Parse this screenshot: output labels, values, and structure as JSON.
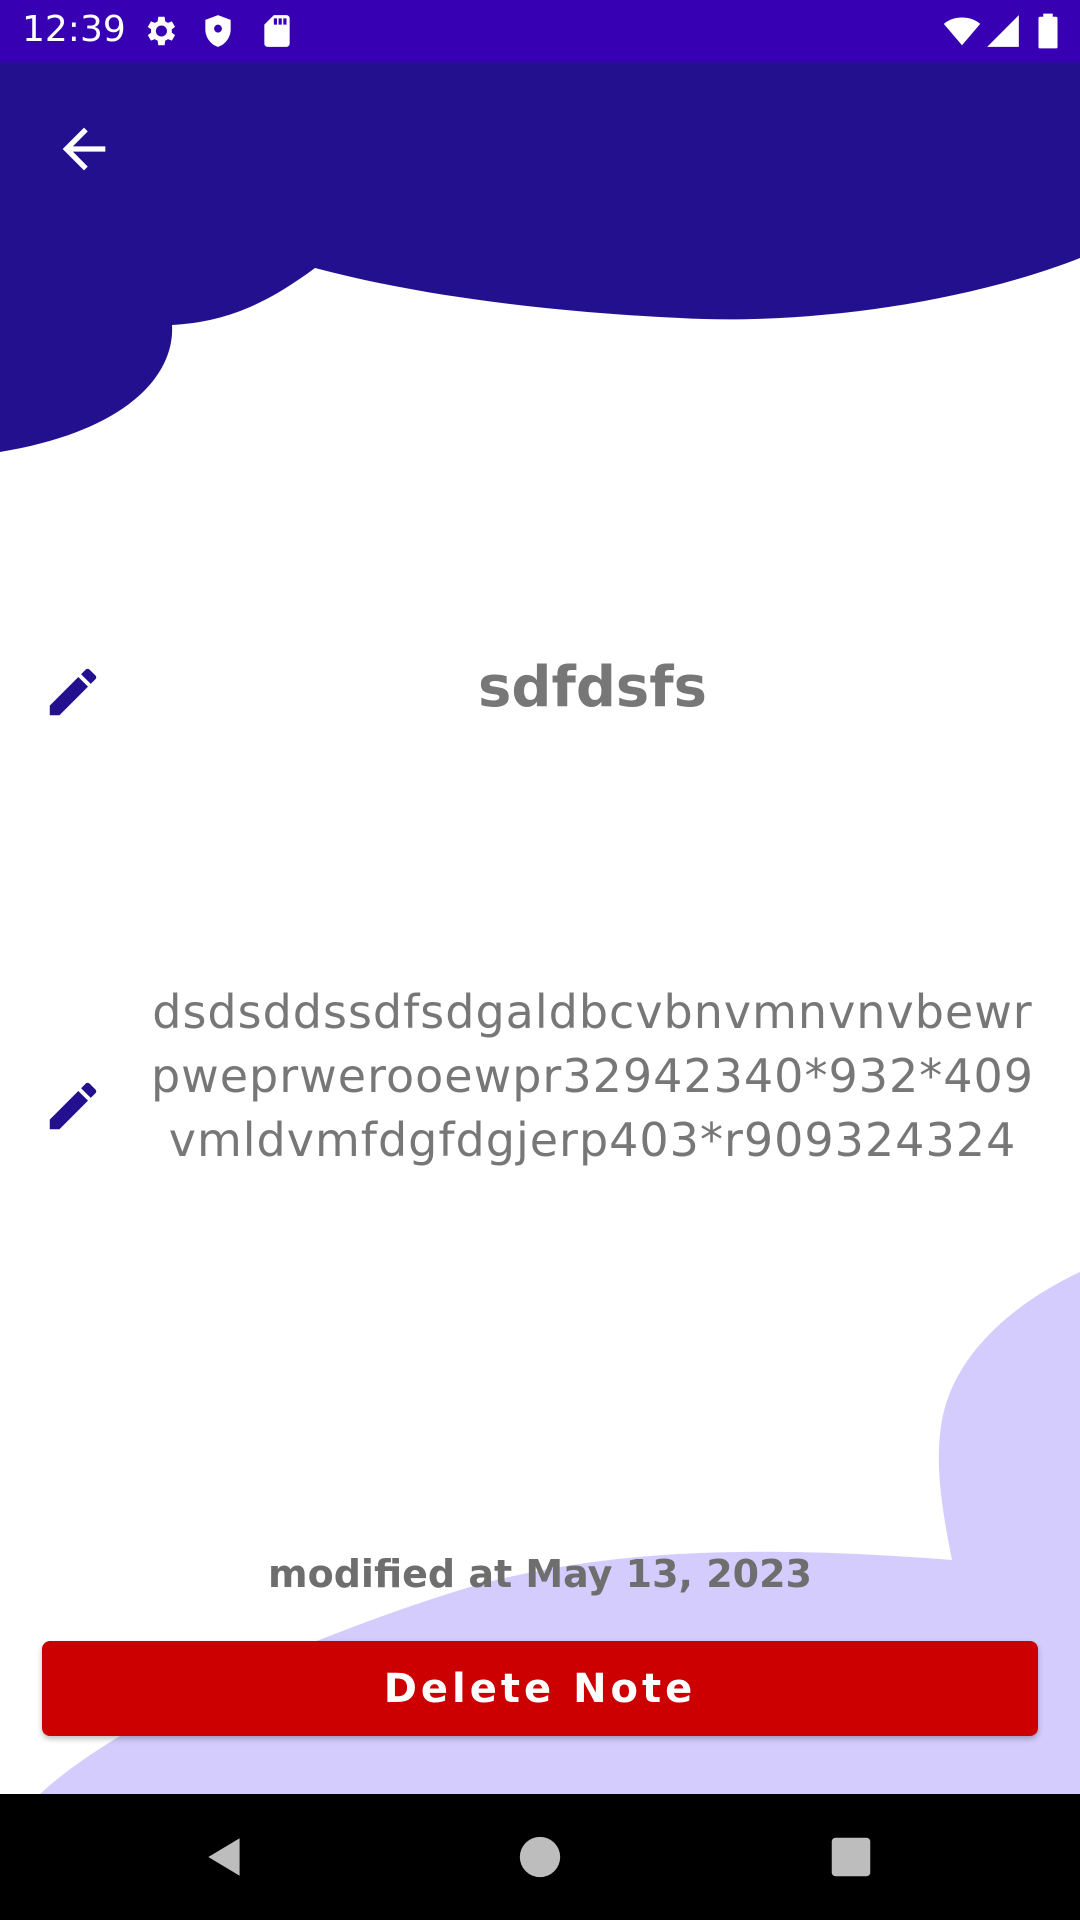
{
  "status_bar": {
    "time": "12:39",
    "icons": [
      "settings-icon",
      "shield-icon",
      "sd-card-icon",
      "wifi-icon",
      "signal-icon",
      "battery-icon"
    ]
  },
  "header": {
    "back_icon": "arrow-back-icon"
  },
  "note": {
    "title": "sdfdsfs",
    "body": "dsdsddssdfsdgaldbcvbnvmnvnvbewrpweprwerooewpr32942340*932*409vmldvmfdgfdgjerp403*r909324324",
    "edit_icon": "pencil-icon"
  },
  "modified_label": "modified at May 13, 2023",
  "delete_button_label": "Delete Note",
  "nav_bar": {
    "icons": [
      "back-triangle-icon",
      "home-circle-icon",
      "recents-square-icon"
    ]
  },
  "colors": {
    "status_bar": "#3700b3",
    "header": "#23108f",
    "accent_blob": "#d4ccfc",
    "delete": "#cc0000",
    "text": "#777777"
  }
}
